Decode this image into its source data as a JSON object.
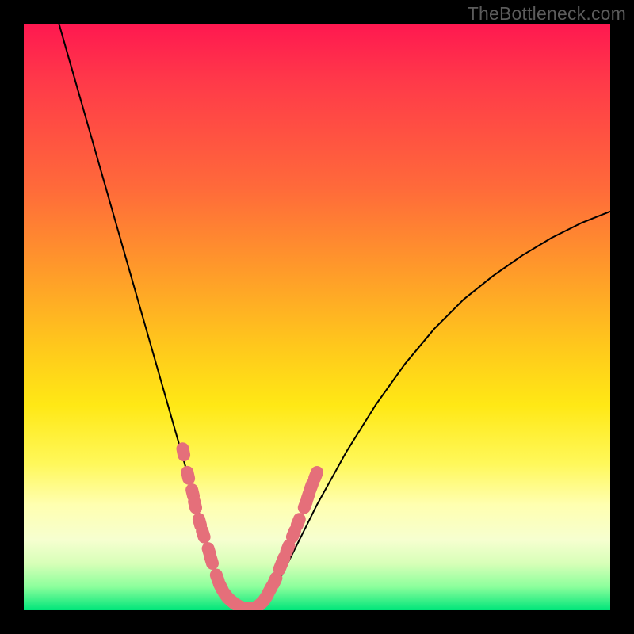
{
  "attribution": "TheBottleneck.com",
  "chart_data": {
    "type": "line",
    "title": "",
    "xlabel": "",
    "ylabel": "",
    "xlim": [
      0,
      100
    ],
    "ylim": [
      0,
      100
    ],
    "series": [
      {
        "name": "curve",
        "x": [
          6,
          8,
          10,
          12,
          14,
          16,
          18,
          20,
          22,
          24,
          26,
          28,
          30,
          31,
          32,
          33,
          34,
          35,
          36,
          37,
          38,
          39,
          40,
          42,
          44,
          46,
          50,
          55,
          60,
          65,
          70,
          75,
          80,
          85,
          90,
          95,
          100
        ],
        "y": [
          100,
          93,
          86,
          79,
          72,
          65,
          58,
          51,
          44,
          37,
          30,
          23,
          16,
          12.5,
          9,
          6,
          3.8,
          2.2,
          1,
          0.5,
          0.3,
          0.5,
          1,
          3,
          6,
          10,
          18,
          27,
          35,
          42,
          48,
          53,
          57,
          60.5,
          63.5,
          66,
          68
        ]
      }
    ],
    "markers": {
      "name": "highlight-points",
      "color": "#e56f7a",
      "points": [
        {
          "x": 27.2,
          "y": 27
        },
        {
          "x": 28.0,
          "y": 23
        },
        {
          "x": 28.8,
          "y": 20
        },
        {
          "x": 29.2,
          "y": 18
        },
        {
          "x": 30.0,
          "y": 15
        },
        {
          "x": 30.6,
          "y": 13
        },
        {
          "x": 31.6,
          "y": 10
        },
        {
          "x": 32.0,
          "y": 8.5
        },
        {
          "x": 33.0,
          "y": 5.5
        },
        {
          "x": 33.6,
          "y": 4
        },
        {
          "x": 34.5,
          "y": 2.5
        },
        {
          "x": 35.5,
          "y": 1.5
        },
        {
          "x": 36.5,
          "y": 0.8
        },
        {
          "x": 37.5,
          "y": 0.4
        },
        {
          "x": 38.5,
          "y": 0.3
        },
        {
          "x": 39.5,
          "y": 0.5
        },
        {
          "x": 40.5,
          "y": 1.2
        },
        {
          "x": 41.3,
          "y": 2.2
        },
        {
          "x": 42.0,
          "y": 3.5
        },
        {
          "x": 42.8,
          "y": 5
        },
        {
          "x": 43.8,
          "y": 7.5
        },
        {
          "x": 44.2,
          "y": 8.5
        },
        {
          "x": 45.0,
          "y": 10.5
        },
        {
          "x": 46.0,
          "y": 13
        },
        {
          "x": 46.8,
          "y": 15
        },
        {
          "x": 48.0,
          "y": 18
        },
        {
          "x": 48.5,
          "y": 19.5
        },
        {
          "x": 49.0,
          "y": 21
        },
        {
          "x": 49.8,
          "y": 23
        }
      ]
    }
  }
}
